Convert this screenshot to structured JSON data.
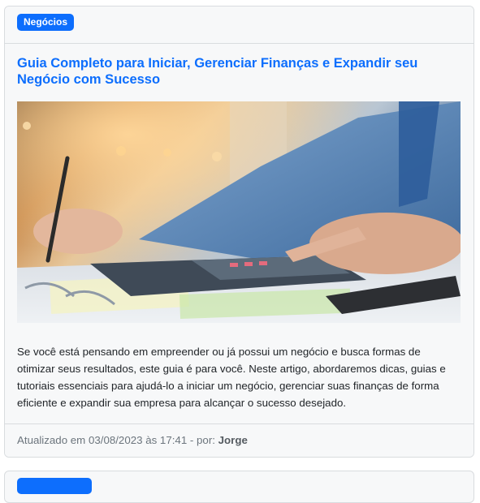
{
  "post": {
    "category": "Negócios",
    "title": "Guia Completo para Iniciar, Gerenciar Finanças e Expandir seu Negócio com Sucesso",
    "image_subject": "business-finance-photo",
    "excerpt": "Se você está pensando em empreender ou já possui um negócio e busca formas de otimizar seus resultados, este guia é para você. Neste artigo, abordaremos dicas, guias e tutoriais essenciais para ajudá-lo a iniciar um negócio, gerenciar suas finanças de forma eficiente e expandir sua empresa para alcançar o sucesso desejado.",
    "footer": {
      "updated_prefix": "Atualizado em 03/08/2023 às 17:41 - por: ",
      "author": "Jorge"
    }
  },
  "colors": {
    "accent": "#0d6efd",
    "card_bg": "#f7f8f9",
    "border": "#d9dcdf",
    "text": "#212529",
    "muted": "#6c757d"
  }
}
